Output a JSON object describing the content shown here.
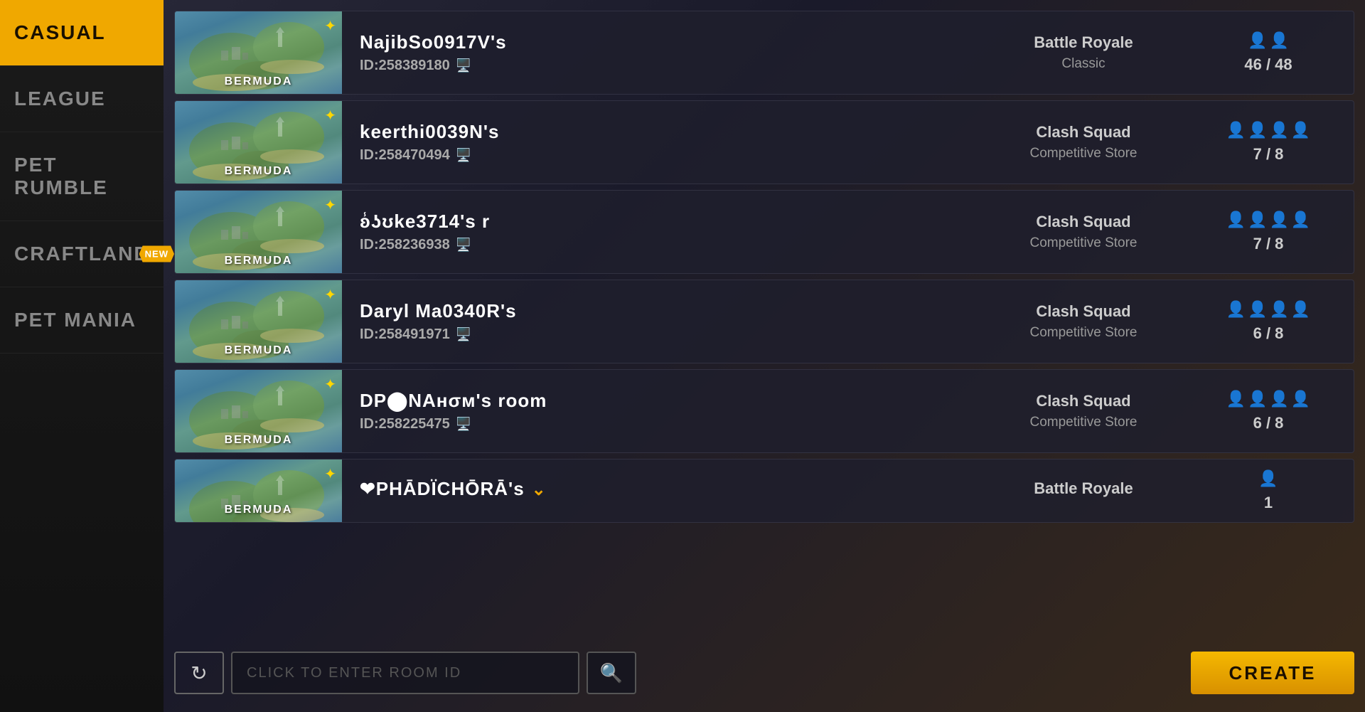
{
  "sidebar": {
    "items": [
      {
        "id": "casual",
        "label": "CASUAL",
        "active": true,
        "new": false
      },
      {
        "id": "league",
        "label": "LEAGUE",
        "active": false,
        "new": false
      },
      {
        "id": "pet-rumble",
        "label": "PET RUMBLE",
        "active": false,
        "new": false
      },
      {
        "id": "craftland",
        "label": "CRAFTLAND",
        "active": false,
        "new": true
      },
      {
        "id": "pet-mania",
        "label": "PET MANIA",
        "active": false,
        "new": false
      }
    ]
  },
  "rooms": [
    {
      "id": "room1",
      "name": "NajibSo0917V's",
      "room_id": "ID:258389180",
      "map": "BERMUDA",
      "mode_type": "Battle Royale",
      "mode_subtype": "Classic",
      "player_count": "46 / 48",
      "player_icons_count": 2,
      "is_full": false
    },
    {
      "id": "room2",
      "name": "keerthi0039N's",
      "room_id": "ID:258470494",
      "map": "BERMUDA",
      "mode_type": "Clash Squad",
      "mode_subtype": "Competitive Store",
      "player_count": "7 / 8",
      "player_icons_count": 4,
      "is_full": false
    },
    {
      "id": "room3",
      "name": "ʚ̾ʖʊke3714's r",
      "room_id": "ID:258236938",
      "map": "BERMUDA",
      "mode_type": "Clash Squad",
      "mode_subtype": "Competitive Store",
      "player_count": "7 / 8",
      "player_icons_count": 4,
      "is_full": false
    },
    {
      "id": "room4",
      "name": "Daryl Ma0340R's",
      "room_id": "ID:258491971",
      "map": "BERMUDA",
      "mode_type": "Clash Squad",
      "mode_subtype": "Competitive Store",
      "player_count": "6 / 8",
      "player_icons_count": 4,
      "is_full": false
    },
    {
      "id": "room5",
      "name": "DP⬤NAнσм's room",
      "room_id": "ID:258225475",
      "map": "BERMUDA",
      "mode_type": "Clash Squad",
      "mode_subtype": "Competitive Store",
      "player_count": "6 / 8",
      "player_icons_count": 4,
      "is_full": false
    },
    {
      "id": "room6",
      "name": "❤PHĀDÏCHŌRĀ's",
      "room_id": "",
      "map": "BERMUDA",
      "mode_type": "Battle Royale",
      "mode_subtype": "",
      "player_count": "1",
      "player_icons_count": 1,
      "is_full": false,
      "partial": true
    }
  ],
  "bottom_bar": {
    "refresh_icon": "↻",
    "search_icon": "🔍",
    "input_placeholder": "CLICK TO ENTER ROOM ID",
    "create_label": "CREATE"
  },
  "colors": {
    "accent": "#f0a800",
    "sidebar_active_bg": "#f0a800",
    "sidebar_active_text": "#1a1000"
  }
}
